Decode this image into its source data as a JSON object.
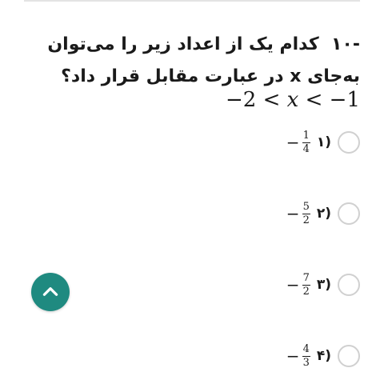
{
  "question": {
    "number": "-۱۰",
    "line1": "کدام یک از اعداد زیر را می‌توان",
    "line2": "به‌جای x در عبارت مقابل قرار داد؟",
    "inequality": {
      "left": "−2",
      "lt1": "<",
      "var": "x",
      "lt2": "<",
      "right": "−1"
    }
  },
  "options": [
    {
      "label": "۱)",
      "sign": "−",
      "numerator": "1",
      "denominator": "4"
    },
    {
      "label": "۲)",
      "sign": "−",
      "numerator": "5",
      "denominator": "2"
    },
    {
      "label": "۳)",
      "sign": "−",
      "numerator": "7",
      "denominator": "2"
    },
    {
      "label": "۴)",
      "sign": "−",
      "numerator": "4",
      "denominator": "3"
    }
  ],
  "colors": {
    "accent": "#1f8a80",
    "radio_border": "#d0d0d0",
    "divider": "#e3e3e3"
  },
  "icons": {
    "scroll_up": "chevron-up-icon"
  }
}
